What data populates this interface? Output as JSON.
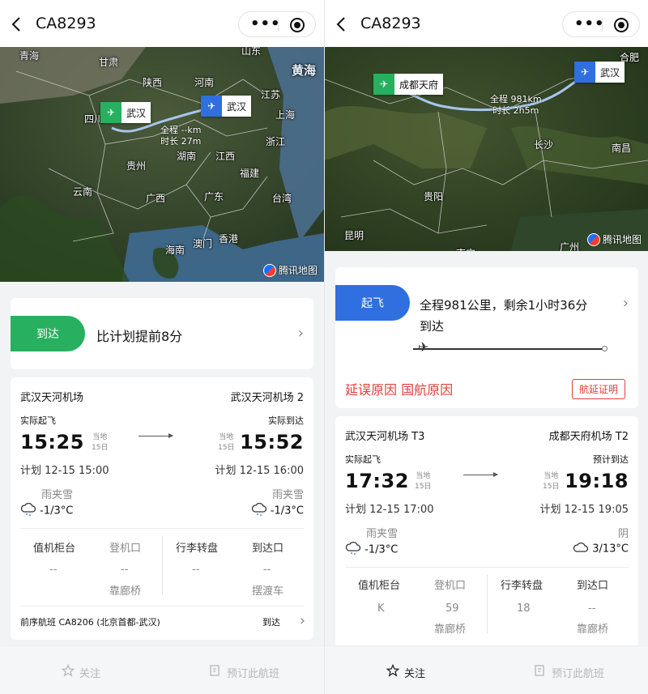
{
  "left": {
    "header": {
      "flight_no": "CA8293"
    },
    "map": {
      "labels": [
        "青海",
        "甘肃",
        "陕西",
        "河南",
        "山东",
        "黄海",
        "四川",
        "江苏",
        "上海",
        "贵州",
        "湖南",
        "江西",
        "浙江",
        "福建",
        "云南",
        "广西",
        "广东",
        "台湾",
        "香港",
        "澳门",
        "海南"
      ],
      "dep_airport": "武汉",
      "arr_airport": "武汉",
      "route_total": "全程 --km",
      "route_time": "时长 27m",
      "provider": "腾讯地图"
    },
    "status": {
      "label": "到达",
      "text": "比计划提前8分"
    },
    "detail": {
      "dep_airport": "武汉天河机场",
      "arr_airport": "武汉天河机场 2",
      "dep_kind": "实际起飞",
      "arr_kind": "实际到达",
      "dep_time": "15:25",
      "arr_time": "15:52",
      "dep_local": "当地",
      "dep_day": "15日",
      "arr_local": "当地",
      "arr_day": "15日",
      "dep_plan": "计划 12-15 15:00",
      "arr_plan": "计划 12-15 16:00",
      "dep_weather": "雨夹雪",
      "dep_temp": "-1/3°C",
      "arr_weather": "雨夹雪",
      "arr_temp": "-1/3°C",
      "grid_headers": [
        "值机柜台",
        "登机口",
        "行李转盘",
        "到达口"
      ],
      "grid_values": [
        "--",
        "--",
        "--",
        "--"
      ],
      "grid_sub": [
        "",
        "靠廊桥",
        "",
        "摆渡车"
      ],
      "prev_flight": "前序航班 CA8206 (北京首都-武汉)",
      "prev_status": "到达"
    },
    "footer": {
      "follow": "关注",
      "book": "预订此航班"
    }
  },
  "right": {
    "header": {
      "flight_no": "CA8293"
    },
    "map": {
      "labels": [
        "合肥",
        "长沙",
        "南昌",
        "贵阳",
        "昆明",
        "广州",
        "南宁"
      ],
      "dep_airport": "成都天府",
      "arr_airport": "武汉",
      "route_total": "全程 981km",
      "route_time": "时长 2h5m",
      "provider": "腾讯地图"
    },
    "status": {
      "label": "起飞",
      "line1": "全程981公里，剩余1小时36分",
      "line2": "到达",
      "progress": 0.05
    },
    "delay": {
      "reason": "延误原因 国航原因",
      "cert": "航延证明"
    },
    "detail": {
      "dep_airport": "武汉天河机场 T3",
      "arr_airport": "成都天府机场 T2",
      "dep_kind": "实际起飞",
      "arr_kind": "预计到达",
      "dep_time": "17:32",
      "arr_time": "19:18",
      "dep_local": "当地",
      "dep_day": "15日",
      "arr_local": "当地",
      "arr_day": "15日",
      "dep_plan": "计划 12-15 17:00",
      "arr_plan": "计划 12-15 19:05",
      "dep_weather": "雨夹雪",
      "dep_temp": "-1/3°C",
      "arr_weather": "阴",
      "arr_temp": "3/13°C",
      "grid_headers": [
        "值机柜台",
        "登机口",
        "行李转盘",
        "到达口"
      ],
      "grid_values": [
        "K",
        "59",
        "18",
        "--"
      ],
      "grid_sub": [
        "",
        "靠廊桥",
        "",
        "靠廊桥"
      ]
    },
    "footer": {
      "follow": "关注",
      "book": "预订此航班"
    }
  },
  "colors": {
    "green": "#27b060",
    "blue": "#2f6fe0",
    "red": "#e0413b"
  }
}
